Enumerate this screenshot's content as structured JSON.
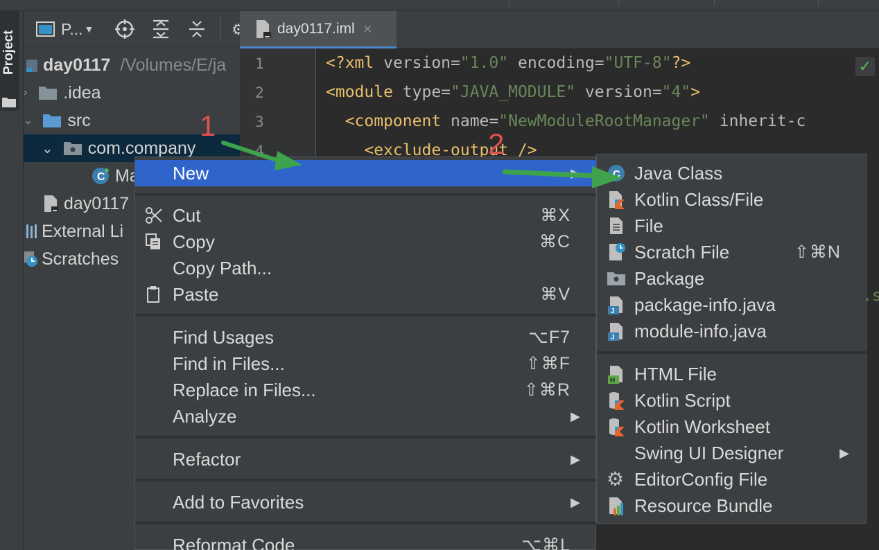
{
  "project_panel": {
    "tool_window_label": "Project",
    "view_selector_label": "P...",
    "tree": [
      {
        "label": "day0117",
        "path": "/Volumes/E/ja"
      },
      {
        "label": ".idea"
      },
      {
        "label": "src"
      },
      {
        "label": "com.company"
      },
      {
        "label": "Ma"
      },
      {
        "label": "day0117"
      },
      {
        "label": "External Li"
      },
      {
        "label": "Scratches"
      }
    ]
  },
  "editor": {
    "tab_label": "day0117.iml",
    "tab_close": "×",
    "line_numbers": [
      "1",
      "2",
      "3",
      "4"
    ],
    "lines": {
      "l1": {
        "open": "<?xml ",
        "attr1": "version=",
        "val1": "\"1.0\"",
        "attr2": " encoding=",
        "val2": "\"UTF-8\"",
        "close": "?>"
      },
      "l2": {
        "open": "<module ",
        "attr1": "type=",
        "val1": "\"JAVA_MODULE\"",
        "attr2": " version=",
        "val2": "\"4\"",
        "close": ">"
      },
      "l3": {
        "open": "  <component ",
        "attr1": "name=",
        "val1": "\"NewModuleRootManager\"",
        "attr2": " inherit-c",
        "val2": "",
        "close": ""
      },
      "l4": {
        "text": "    <exclude-output />"
      }
    },
    "fragment": ".s"
  },
  "context_menu": {
    "items": [
      {
        "label": "New",
        "arrow": "▶"
      },
      {
        "label": "Cut",
        "shortcut": "⌘X"
      },
      {
        "label": "Copy",
        "shortcut": "⌘C"
      },
      {
        "label": "Copy Path..."
      },
      {
        "label": "Paste",
        "shortcut": "⌘V"
      },
      {
        "label": "Find Usages",
        "shortcut": "⌥F7"
      },
      {
        "label": "Find in Files...",
        "shortcut": "⇧⌘F"
      },
      {
        "label": "Replace in Files...",
        "shortcut": "⇧⌘R"
      },
      {
        "label": "Analyze",
        "arrow": "▶"
      },
      {
        "label": "Refactor",
        "arrow": "▶"
      },
      {
        "label": "Add to Favorites",
        "arrow": "▶"
      },
      {
        "label": "Reformat Code",
        "shortcut": "⌥⌘L"
      }
    ]
  },
  "new_submenu": {
    "items": [
      {
        "label": "Java Class"
      },
      {
        "label": "Kotlin Class/File"
      },
      {
        "label": "File"
      },
      {
        "label": "Scratch File",
        "shortcut": "⇧⌘N"
      },
      {
        "label": "Package"
      },
      {
        "label": "package-info.java"
      },
      {
        "label": "module-info.java"
      },
      {
        "label": "HTML File"
      },
      {
        "label": "Kotlin Script"
      },
      {
        "label": "Kotlin Worksheet"
      },
      {
        "label": "Swing UI Designer",
        "arrow": "▶"
      },
      {
        "label": "EditorConfig File"
      },
      {
        "label": "Resource Bundle"
      }
    ]
  },
  "annotations": {
    "step1": "1",
    "step2": "2"
  },
  "colors": {
    "highlight": "#2f65ca",
    "arrow_green": "#3fa34d",
    "annotation_red": "#e05050",
    "folder": "#87939a",
    "source_folder": "#5b9bd5"
  }
}
